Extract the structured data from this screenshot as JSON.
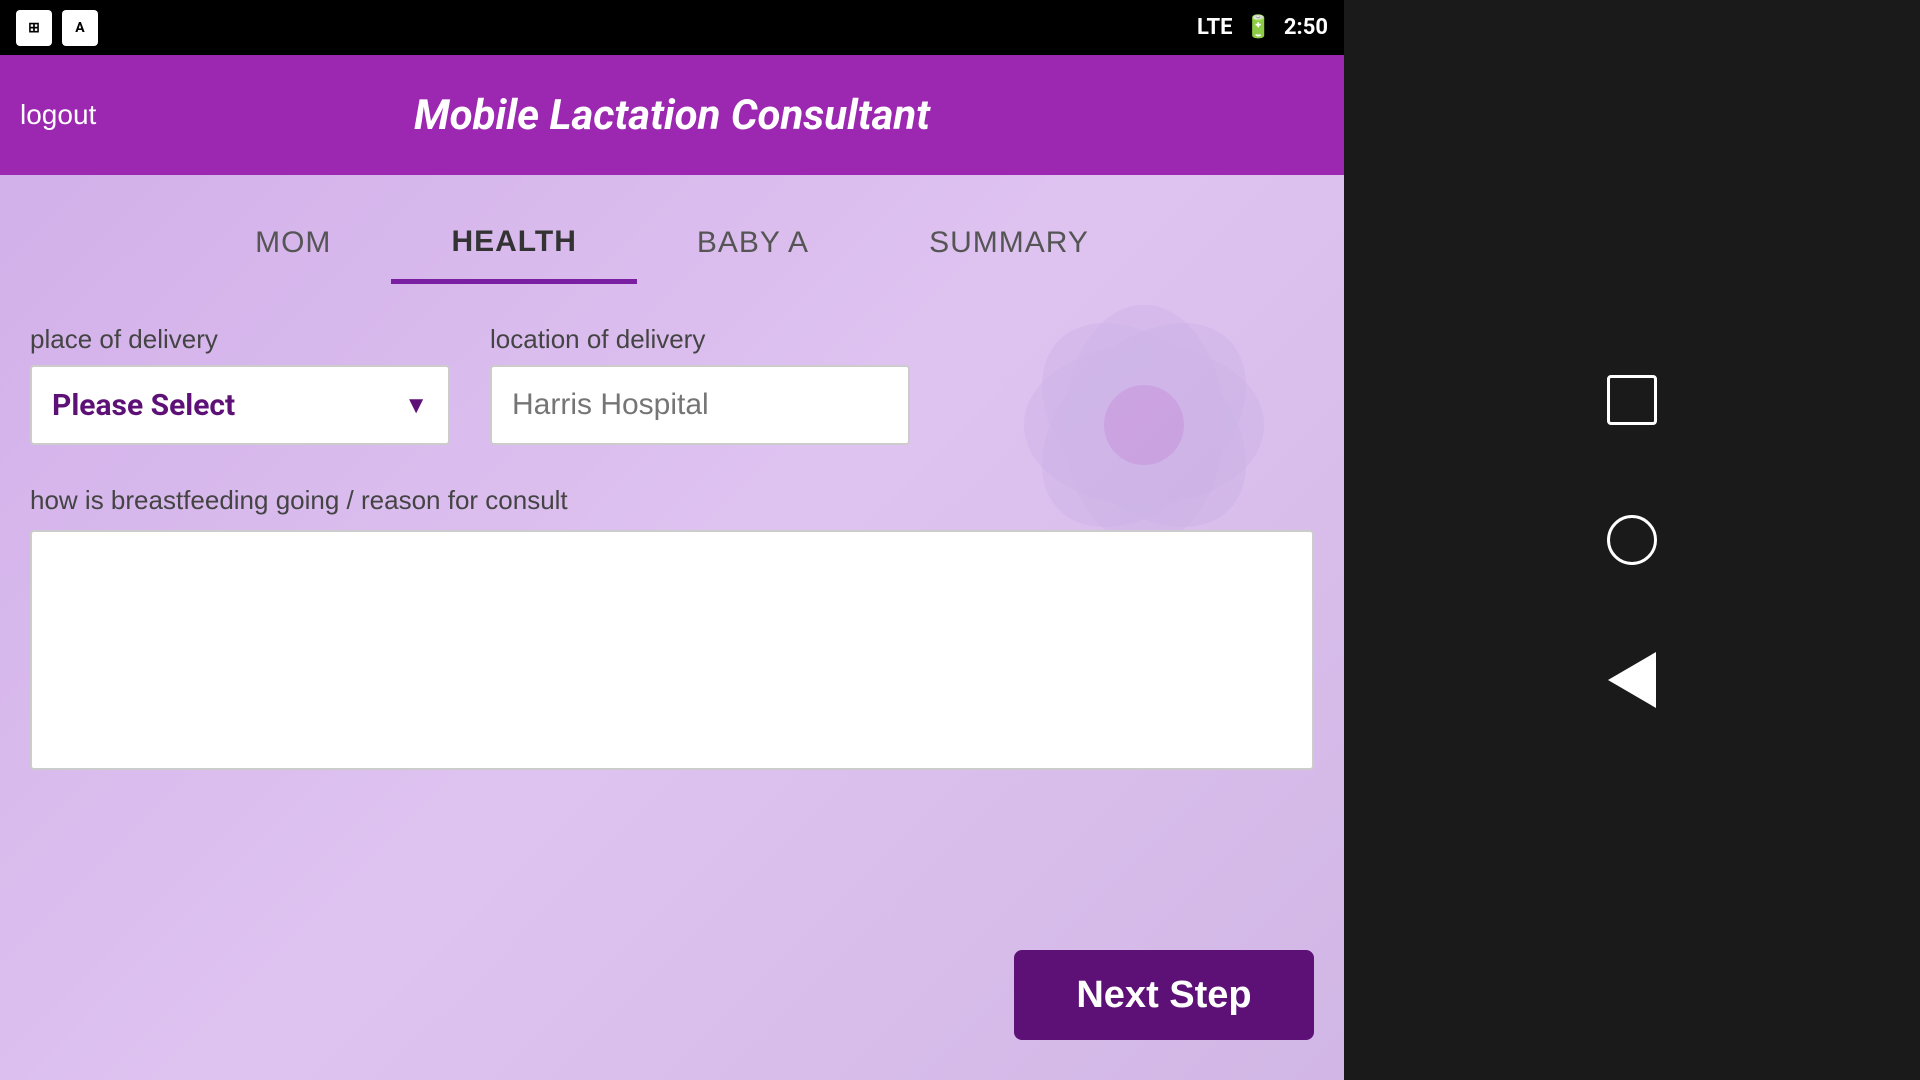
{
  "statusBar": {
    "icons": [
      "grid-icon",
      "a-icon"
    ],
    "network": "LTE",
    "time": "2:50"
  },
  "header": {
    "logoutLabel": "logout",
    "title": "Mobile Lactation Consultant"
  },
  "tabs": [
    {
      "label": "MOM",
      "active": false
    },
    {
      "label": "HEALTH",
      "active": true
    },
    {
      "label": "BABY A",
      "active": false
    },
    {
      "label": "SUMMARY",
      "active": false
    }
  ],
  "form": {
    "placeOfDeliveryLabel": "place of delivery",
    "placeOfDeliveryValue": "Please Select",
    "locationOfDeliveryLabel": "location of delivery",
    "locationOfDeliveryPlaceholder": "Harris Hospital",
    "breastfeedingLabel": "how is breastfeeding going / reason for consult",
    "breastfeedingValue": ""
  },
  "buttons": {
    "nextStep": "Next Step"
  }
}
